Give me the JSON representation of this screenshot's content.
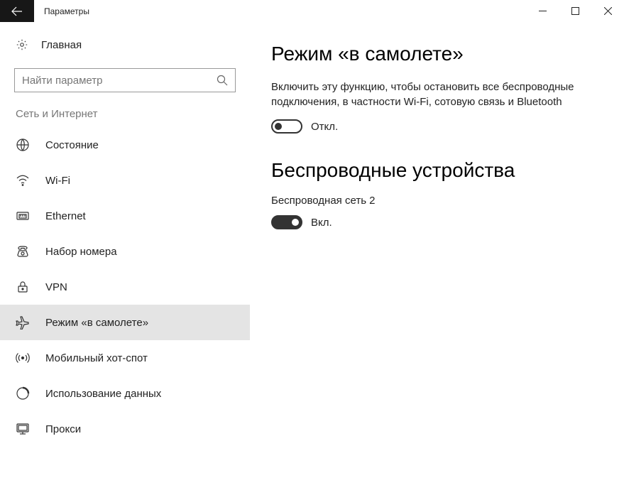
{
  "window": {
    "title": "Параметры"
  },
  "sidebar": {
    "home_label": "Главная",
    "search_placeholder": "Найти параметр",
    "category_label": "Сеть и Интернет",
    "items": [
      {
        "label": "Состояние",
        "icon": "status"
      },
      {
        "label": "Wi-Fi",
        "icon": "wifi"
      },
      {
        "label": "Ethernet",
        "icon": "ethernet"
      },
      {
        "label": "Набор номера",
        "icon": "dialup"
      },
      {
        "label": "VPN",
        "icon": "vpn"
      },
      {
        "label": "Режим «в самолете»",
        "icon": "airplane",
        "active": true
      },
      {
        "label": "Мобильный хот-спот",
        "icon": "hotspot"
      },
      {
        "label": "Использование данных",
        "icon": "datausage"
      },
      {
        "label": "Прокси",
        "icon": "proxy"
      }
    ]
  },
  "main": {
    "heading": "Режим «в самолете»",
    "description": "Включить эту функцию, чтобы остановить все беспроводные подключения, в частности Wi-Fi, сотовую связь и Bluetooth",
    "airplane_toggle": {
      "state": "off",
      "label": "Откл."
    },
    "wireless_heading": "Беспроводные устройства",
    "wireless_device_label": "Беспроводная сеть 2",
    "wireless_toggle": {
      "state": "on",
      "label": "Вкл."
    }
  }
}
